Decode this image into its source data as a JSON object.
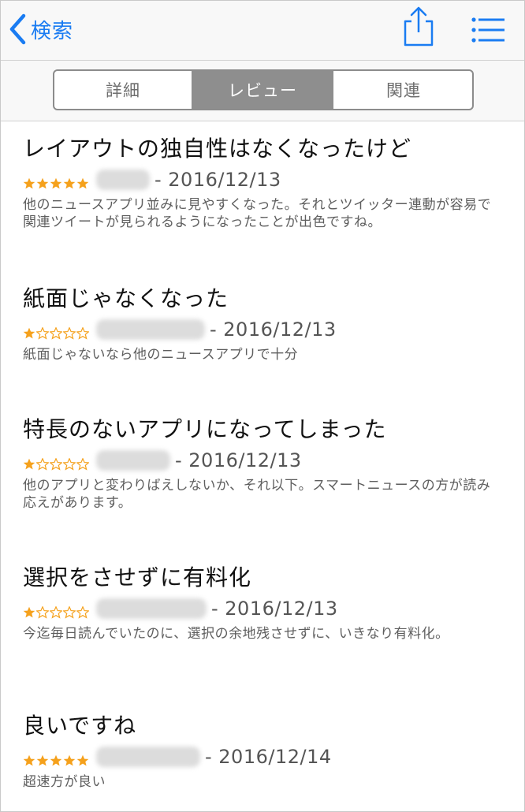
{
  "nav": {
    "back_label": "検索"
  },
  "segments": [
    "詳細",
    "レビュー",
    "関連"
  ],
  "reviews": [
    {
      "title": "レイアウトの独自性はなくなったけど",
      "rating": 5,
      "date": "- 2016/12/13",
      "body": "他のニュースアプリ並みに見やすくなった。それとツイッター連動が容易で関連ツイートが見られるようになったことが出色ですね。"
    },
    {
      "title": "紙面じゃなくなった",
      "rating": 1,
      "date": "- 2016/12/13",
      "body": "紙面じゃないなら他のニュースアプリで十分"
    },
    {
      "title": "特長のないアプリになってしまった",
      "rating": 1,
      "date": "- 2016/12/13",
      "body": "他のアプリと変わりばえしないか、それ以下。スマートニュースの方が読み応えがあります。"
    },
    {
      "title": "選択をさせずに有料化",
      "rating": 1,
      "date": "- 2016/12/13",
      "body": "今迄毎日読んでいたのに、選択の余地残させずに、いきなり有料化。"
    },
    {
      "title": "良いですね",
      "rating": 5,
      "date": "- 2016/12/14",
      "body": "超速方が良い"
    }
  ],
  "colors": {
    "accent": "#1a7cf2",
    "star": "#f5a11c",
    "segment_selected": "#8e8e8e"
  },
  "icons": {
    "back": "chevron-left-icon",
    "share": "share-icon",
    "menu": "list-icon",
    "star_filled": "star-filled-icon",
    "star_empty": "star-empty-icon"
  }
}
